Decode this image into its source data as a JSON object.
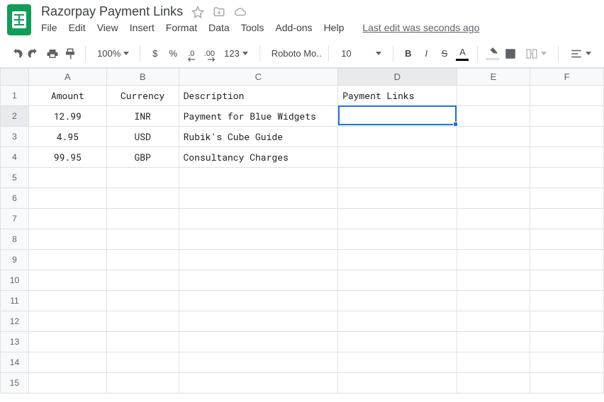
{
  "doc": {
    "title": "Razorpay Payment Links",
    "last_edit": "Last edit was seconds ago"
  },
  "menu": {
    "file": "File",
    "edit": "Edit",
    "view": "View",
    "insert": "Insert",
    "format": "Format",
    "data": "Data",
    "tools": "Tools",
    "addons": "Add-ons",
    "help": "Help"
  },
  "toolbar": {
    "zoom": "100%",
    "currency": "$",
    "percent": "%",
    "dec_dec": ".0",
    "inc_dec": ".00",
    "numfmt": "123",
    "font": "Roboto Mo...",
    "size": "10",
    "bold": "B",
    "strike": "S",
    "text_color_letter": "A",
    "text_color_underline": "#000000",
    "fill_color_underline": "#ffffff"
  },
  "columns": {
    "A": "A",
    "B": "B",
    "C": "C",
    "D": "D",
    "E": "E",
    "F": "F"
  },
  "rows": {
    "r1": "1",
    "r2": "2",
    "r3": "3",
    "r4": "4",
    "r5": "5",
    "r6": "6",
    "r7": "7",
    "r8": "8",
    "r9": "9",
    "r10": "10",
    "r11": "11",
    "r12": "12",
    "r13": "13",
    "r14": "14",
    "r15": "15"
  },
  "cells": {
    "A1": "Amount",
    "B1": "Currency",
    "C1": "Description",
    "D1": "Payment Links",
    "A2": "12.99",
    "B2": "INR",
    "C2": "Payment for Blue Widgets",
    "A3": "4.95",
    "B3": "USD",
    "C3": "Rubik's Cube Guide",
    "A4": "99.95",
    "B4": "GBP",
    "C4": "Consultancy Charges"
  },
  "active_cell": "D2"
}
